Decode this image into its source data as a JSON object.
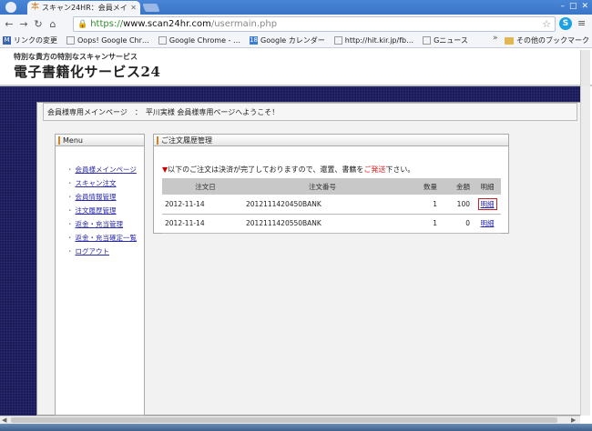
{
  "browser": {
    "tab_title": "スキャン24HR：会員メイ",
    "url_scheme": "https://",
    "url_host": "www.scan24hr.com",
    "url_path": "/usermain.php",
    "bookmarks": [
      {
        "label": "リンクの変更",
        "icon": "bookmark-m-icon"
      },
      {
        "label": "Oops! Google Chr…",
        "icon": "page-icon"
      },
      {
        "label": "Google Chrome - …",
        "icon": "page-icon"
      },
      {
        "label": "Google カレンダー",
        "icon": "calendar-icon"
      },
      {
        "label": "http://hit.kir.jp/fb…",
        "icon": "page-icon"
      },
      {
        "label": "Gニュース",
        "icon": "page-icon"
      }
    ],
    "bookmarks_folder": "その他のブックマーク"
  },
  "site": {
    "tagline": "特別な貴方の特別なスキャンサービス",
    "logo": "電子書籍化サービス24"
  },
  "breadcrumb": "会員様専用メインページ　：　平川実様 会員様専用ページへようこそ！",
  "sidebar": {
    "title": "Menu",
    "items": [
      "会員様メインページ",
      "スキャン注文",
      "会員情報管理",
      "注文履歴管理",
      "返金・充当管理",
      "返金・充当確定一覧",
      "ログアウト"
    ]
  },
  "panel": {
    "title": "ご注文履歴管理",
    "notice_marker": "▼",
    "notice_before": "以下のご注文は決済が完了しておりますので、還置、書籍を",
    "notice_highlight": "ご発送",
    "notice_after": "下さい。",
    "headers": {
      "date": "注文日",
      "number": "注文番号",
      "qty": "数量",
      "amount": "金額",
      "detail": "明細"
    },
    "rows": [
      {
        "date": "2012-11-14",
        "number": "2012111420450BANK",
        "qty": "1",
        "amount": "100",
        "detail": "明細"
      },
      {
        "date": "2012-11-14",
        "number": "2012111420550BANK",
        "qty": "1",
        "amount": "0",
        "detail": "明細"
      }
    ]
  }
}
